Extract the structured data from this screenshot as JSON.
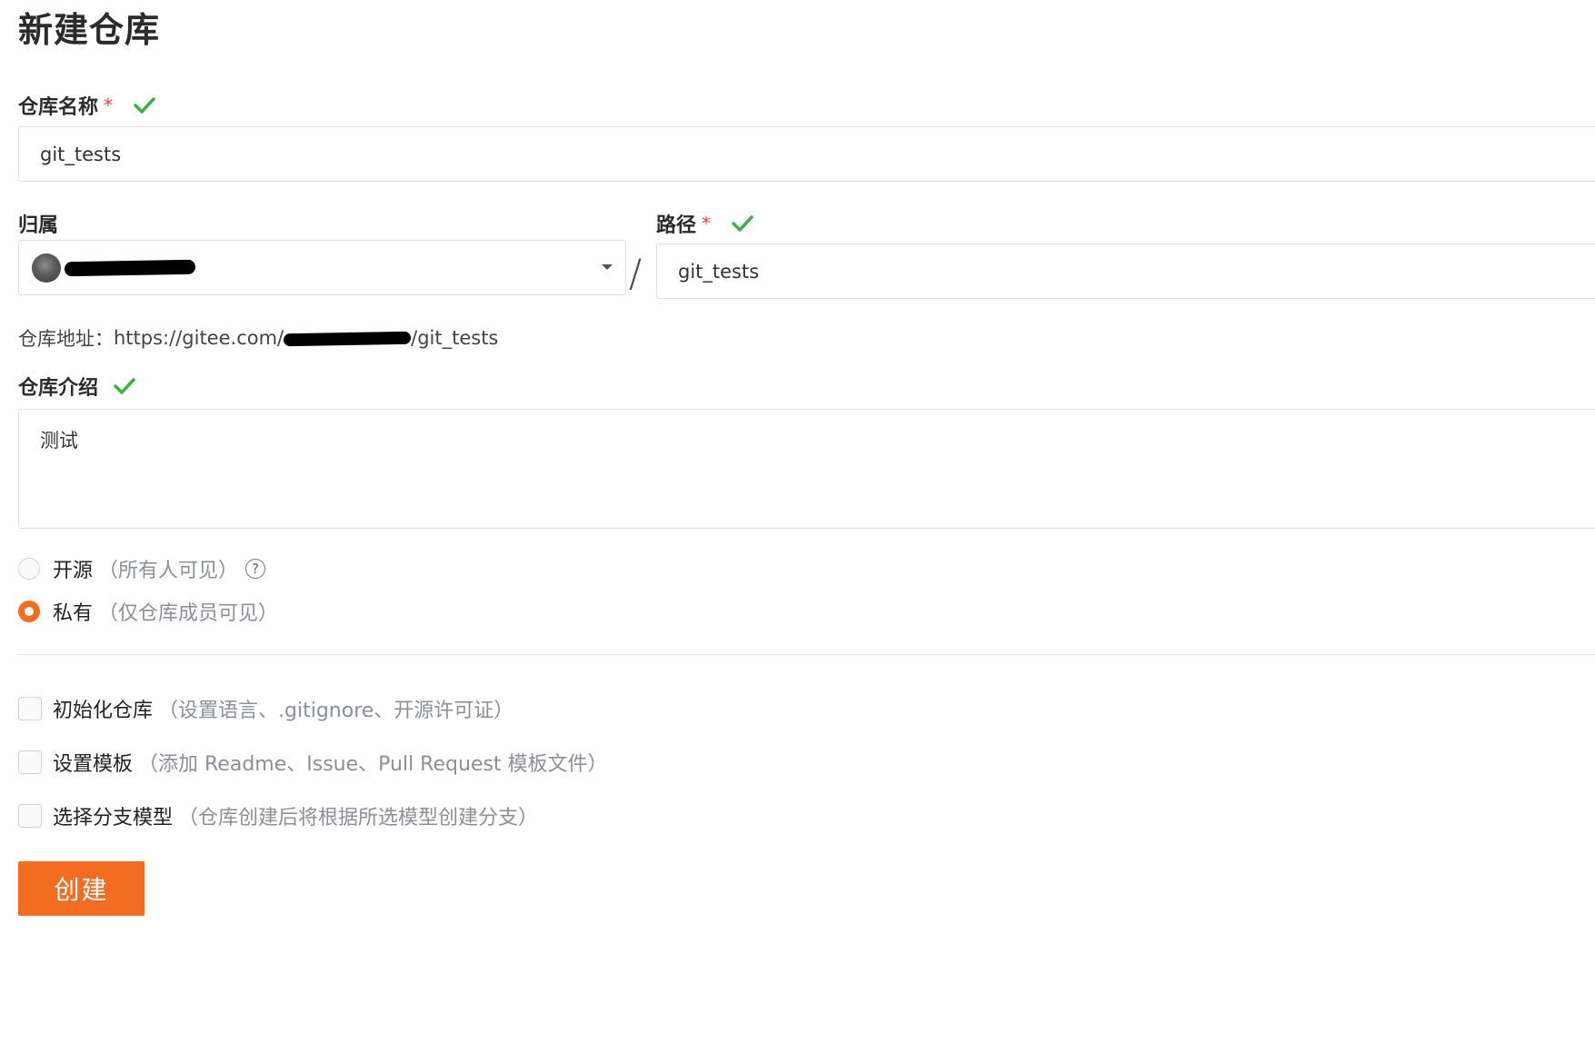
{
  "page": {
    "title": "新建仓库"
  },
  "repo_name": {
    "label": "仓库名称",
    "required_mark": "*",
    "value": "git_tests"
  },
  "owner": {
    "label": "归属"
  },
  "path": {
    "label": "路径",
    "required_mark": "*",
    "separator": "/",
    "value": "git_tests"
  },
  "address": {
    "label": "仓库地址：",
    "prefix": "https://gitee.com/",
    "suffix": "/git_tests"
  },
  "description": {
    "label": "仓库介绍",
    "value": "测试"
  },
  "visibility": {
    "public": {
      "label": "开源",
      "hint": "（所有人可见）",
      "checked": false
    },
    "private": {
      "label": "私有",
      "hint": "（仅仓库成员可见）",
      "checked": true
    }
  },
  "options": {
    "init_repo": {
      "label": "初始化仓库",
      "hint": "（设置语言、.gitignore、开源许可证）"
    },
    "template": {
      "label": "设置模板",
      "hint": "（添加 Readme、Issue、Pull Request 模板文件）"
    },
    "branch_model": {
      "label": "选择分支模型",
      "hint": "（仓库创建后将根据所选模型创建分支）"
    }
  },
  "create_button": {
    "label": "创建"
  },
  "colors": {
    "accent": "#f26d22",
    "check": "#3fae49",
    "required": "#e5453b"
  }
}
